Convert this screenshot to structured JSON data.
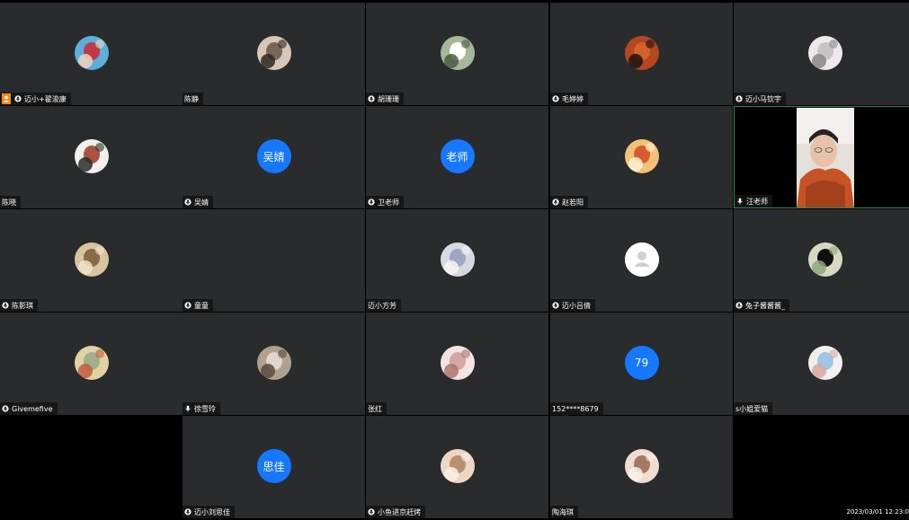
{
  "participants": [
    {
      "name": "迈小+翟浚康",
      "mic": "host",
      "avatar": "photo",
      "colors": [
        "#5ab0d8",
        "#c0394b",
        "#f3d1c1"
      ]
    },
    {
      "name": "陈静",
      "mic": "none",
      "avatar": "photo",
      "colors": [
        "#d8c7b8",
        "#7a6656",
        "#2d2622"
      ]
    },
    {
      "name": "胡珊珊",
      "mic": "icon",
      "avatar": "photo",
      "colors": [
        "#a7b79a",
        "#ffffff",
        "#4d5a44"
      ]
    },
    {
      "name": "毛婷婷",
      "mic": "icon",
      "avatar": "photo",
      "colors": [
        "#b54621",
        "#d2612b",
        "#1a1412"
      ]
    },
    {
      "name": "迈小马钦宇",
      "mic": "icon",
      "avatar": "photo",
      "colors": [
        "#ede9ea",
        "#c8c4c6",
        "#8a8587"
      ]
    },
    {
      "name": "陈晓",
      "mic": "none",
      "avatar": "photo",
      "colors": [
        "#f1f0ee",
        "#a8553c",
        "#2b2b2b"
      ]
    },
    {
      "name": "吴婧",
      "mic": "icon",
      "avatar": "text",
      "avatar_text": "吴婧"
    },
    {
      "name": "卫老师",
      "mic": "icon",
      "avatar": "text",
      "avatar_text": "老师"
    },
    {
      "name": "赵若阳",
      "mic": "icon",
      "avatar": "photo",
      "colors": [
        "#f2c17a",
        "#d65c2e",
        "#fff2d6"
      ]
    },
    {
      "name": "汪老师",
      "mic": "mic",
      "avatar": "video"
    },
    {
      "name": "陈影琪",
      "mic": "icon",
      "avatar": "photo",
      "colors": [
        "#d9c4a0",
        "#8a6a45",
        "#f0e2c8"
      ]
    },
    {
      "name": "童童",
      "mic": "icon",
      "avatar": "none"
    },
    {
      "name": "迈小方芳",
      "mic": "none",
      "avatar": "photo",
      "colors": [
        "#d8d8e3",
        "#9fa6c4",
        "#f7f4f2"
      ]
    },
    {
      "name": "迈小吕倩",
      "mic": "icon",
      "avatar": "default"
    },
    {
      "name": "兔子酱酱酱_",
      "mic": "icon",
      "avatar": "photo",
      "colors": [
        "#d6d9bf",
        "#101010",
        "#8fa77b"
      ]
    },
    {
      "name": "Givemefive",
      "mic": "icon",
      "avatar": "photo",
      "colors": [
        "#e2d1a2",
        "#a1b08c",
        "#c45a3d"
      ]
    },
    {
      "name": "徐雪玲",
      "mic": "mic",
      "avatar": "photo",
      "colors": [
        "#b0a18e",
        "#e0d6cc",
        "#5a4b3e"
      ]
    },
    {
      "name": "张红",
      "mic": "none",
      "avatar": "photo",
      "colors": [
        "#f3e3e4",
        "#d4a7a5",
        "#a9756f"
      ]
    },
    {
      "name": "152****8679",
      "mic": "none",
      "avatar": "text",
      "avatar_text": "79"
    },
    {
      "name": "s小姐爱猫",
      "mic": "none",
      "avatar": "photo",
      "colors": [
        "#f1f0ee",
        "#9ec7e4",
        "#d9a7a0"
      ]
    },
    {
      "name": "",
      "mic": "none",
      "avatar": "empty"
    },
    {
      "name": "迈小刘思佳",
      "mic": "icon",
      "avatar": "text",
      "avatar_text": "思佳"
    },
    {
      "name": "小鱼进京赶烤",
      "mic": "icon",
      "avatar": "photo",
      "colors": [
        "#ecd6c6",
        "#b8906f",
        "#fbeee2"
      ]
    },
    {
      "name": "陶海琪",
      "mic": "none",
      "avatar": "photo",
      "colors": [
        "#f0dcd0",
        "#a47a62",
        "#f8f0ea"
      ]
    },
    {
      "name": "",
      "mic": "none",
      "avatar": "empty"
    }
  ],
  "timestamp": "2023/03/01 12:23:0",
  "colors": {
    "tile_bg": "#2a2b2d",
    "text_avatar_bg": "#1677ff",
    "host_badge": "#f08a1c",
    "active_border": "#1f8f55"
  }
}
